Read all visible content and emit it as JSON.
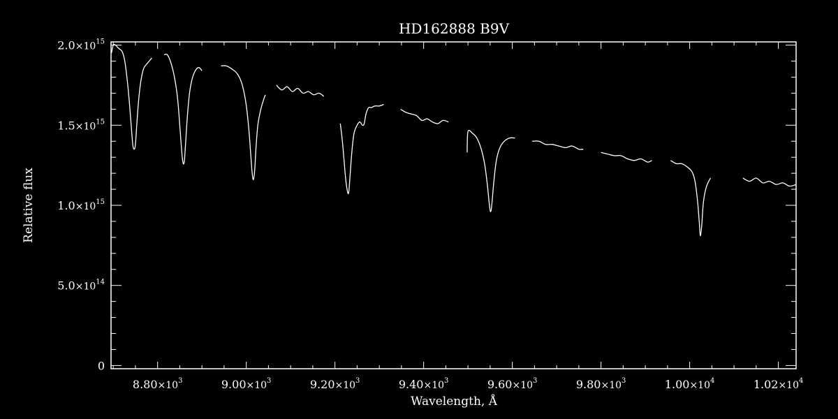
{
  "chart_data": {
    "type": "line",
    "title": "HD162888   B9V",
    "xlabel": "Wavelength, Å",
    "ylabel": "Relative flux",
    "xlim": [
      8695,
      10240
    ],
    "ylim": [
      -20000000000000.0,
      2020000000000000.0
    ],
    "x_ticks": [
      {
        "value": 8800,
        "mant": "8.80",
        "exp": "3"
      },
      {
        "value": 9000,
        "mant": "9.00",
        "exp": "3"
      },
      {
        "value": 9200,
        "mant": "9.20",
        "exp": "3"
      },
      {
        "value": 9400,
        "mant": "9.40",
        "exp": "3"
      },
      {
        "value": 9600,
        "mant": "9.60",
        "exp": "3"
      },
      {
        "value": 9800,
        "mant": "9.80",
        "exp": "3"
      },
      {
        "value": 10000,
        "mant": "1.00",
        "exp": "4"
      },
      {
        "value": 10200,
        "mant": "1.02",
        "exp": "4"
      }
    ],
    "y_ticks": [
      {
        "value": 0,
        "mant": "0",
        "exp": ""
      },
      {
        "value": 500000000000000.0,
        "mant": "5.0",
        "exp": "14"
      },
      {
        "value": 1000000000000000.0,
        "mant": "1.0",
        "exp": "15"
      },
      {
        "value": 1500000000000000.0,
        "mant": "1.5",
        "exp": "15"
      },
      {
        "value": 2000000000000000.0,
        "mant": "2.0",
        "exp": "15"
      }
    ],
    "grid": false,
    "line_color": "#ffffff",
    "background": "#000000",
    "series": [
      {
        "x": [
          8696,
          8700,
          8705,
          8712,
          8720,
          8726,
          8732,
          8737,
          8741,
          8744,
          8747,
          8750,
          8753,
          8757,
          8762,
          8768,
          8775,
          8781,
          8787
        ],
        "y": [
          1950000000000000.0,
          2000000000000000.0,
          2000000000000000.0,
          1980000000000000.0,
          1960000000000000.0,
          1900000000000000.0,
          1770000000000000.0,
          1620000000000000.0,
          1480000000000000.0,
          1380000000000000.0,
          1350000000000000.0,
          1380000000000000.0,
          1500000000000000.0,
          1650000000000000.0,
          1770000000000000.0,
          1850000000000000.0,
          1880000000000000.0,
          1900000000000000.0,
          1920000000000000.0
        ]
      },
      {
        "x": [
          8815,
          8822,
          8830,
          8838,
          8845,
          8850,
          8854,
          8857,
          8860,
          8863,
          8867,
          8872,
          8878,
          8885,
          8893,
          8900
        ],
        "y": [
          1940000000000000.0,
          1940000000000000.0,
          1890000000000000.0,
          1800000000000000.0,
          1670000000000000.0,
          1500000000000000.0,
          1350000000000000.0,
          1270000000000000.0,
          1270000000000000.0,
          1380000000000000.0,
          1550000000000000.0,
          1700000000000000.0,
          1790000000000000.0,
          1840000000000000.0,
          1860000000000000.0,
          1840000000000000.0
        ]
      },
      {
        "x": [
          8943,
          8955,
          8968,
          8980,
          8990,
          8998,
          9005,
          9010,
          9013,
          9016,
          9019,
          9022,
          9026,
          9032,
          9038,
          9043
        ],
        "y": [
          1870000000000000.0,
          1870000000000000.0,
          1850000000000000.0,
          1820000000000000.0,
          1760000000000000.0,
          1660000000000000.0,
          1500000000000000.0,
          1320000000000000.0,
          1210000000000000.0,
          1160000000000000.0,
          1220000000000000.0,
          1360000000000000.0,
          1500000000000000.0,
          1590000000000000.0,
          1650000000000000.0,
          1690000000000000.0
        ]
      },
      {
        "x": [
          9068,
          9080,
          9092,
          9104,
          9116,
          9128,
          9140,
          9152,
          9164,
          9175
        ],
        "y": [
          1750000000000000.0,
          1720000000000000.0,
          1740000000000000.0,
          1710000000000000.0,
          1730000000000000.0,
          1700000000000000.0,
          1710000000000000.0,
          1690000000000000.0,
          1700000000000000.0,
          1680000000000000.0
        ]
      },
      {
        "x": [
          9212,
          9216,
          9220,
          9224,
          9228,
          9231,
          9234,
          9238,
          9243,
          9250,
          9256,
          9262,
          9266,
          9270,
          9276,
          9282,
          9290,
          9300,
          9310
        ],
        "y": [
          1510000000000000.0,
          1420000000000000.0,
          1300000000000000.0,
          1170000000000000.0,
          1090000000000000.0,
          1080000000000000.0,
          1180000000000000.0,
          1330000000000000.0,
          1450000000000000.0,
          1500000000000000.0,
          1520000000000000.0,
          1500000000000000.0,
          1510000000000000.0,
          1570000000000000.0,
          1610000000000000.0,
          1610000000000000.0,
          1620000000000000.0,
          1620000000000000.0,
          1630000000000000.0
        ]
      },
      {
        "x": [
          9348,
          9360,
          9372,
          9384,
          9396,
          9408,
          9420,
          9432,
          9444,
          9456
        ],
        "y": [
          1600000000000000.0,
          1580000000000000.0,
          1570000000000000.0,
          1560000000000000.0,
          1530000000000000.0,
          1540000000000000.0,
          1520000000000000.0,
          1510000000000000.0,
          1530000000000000.0,
          1520000000000000.0
        ]
      },
      {
        "x": [
          9498,
          9500,
          9510,
          9520,
          9530,
          9538,
          9544,
          9548,
          9551,
          9554,
          9558,
          9564,
          9572,
          9582,
          9594,
          9606
        ],
        "y": [
          1330000000000000.0,
          1460000000000000.0,
          1450000000000000.0,
          1420000000000000.0,
          1350000000000000.0,
          1250000000000000.0,
          1120000000000000.0,
          1010000000000000.0,
          960000000000000.0,
          1010000000000000.0,
          1140000000000000.0,
          1280000000000000.0,
          1360000000000000.0,
          1400000000000000.0,
          1420000000000000.0,
          1420000000000000.0
        ]
      },
      {
        "x": [
          9645,
          9660,
          9675,
          9690,
          9705,
          9720,
          9735,
          9750,
          9760
        ],
        "y": [
          1400000000000000.0,
          1400000000000000.0,
          1380000000000000.0,
          1380000000000000.0,
          1370000000000000.0,
          1360000000000000.0,
          1370000000000000.0,
          1350000000000000.0,
          1350000000000000.0
        ]
      },
      {
        "x": [
          9800,
          9815,
          9830,
          9845,
          9860,
          9875,
          9890,
          9905,
          9915
        ],
        "y": [
          1330000000000000.0,
          1320000000000000.0,
          1310000000000000.0,
          1310000000000000.0,
          1290000000000000.0,
          1280000000000000.0,
          1290000000000000.0,
          1270000000000000.0,
          1280000000000000.0
        ]
      },
      {
        "x": [
          9957,
          9970,
          9982,
          9994,
          10005,
          10012,
          10018,
          10022,
          10024,
          10027,
          10031,
          10037,
          10043,
          10047
        ],
        "y": [
          1280000000000000.0,
          1260000000000000.0,
          1260000000000000.0,
          1240000000000000.0,
          1210000000000000.0,
          1150000000000000.0,
          1020000000000000.0,
          880000000000000.0,
          810000000000000.0,
          870000000000000.0,
          1020000000000000.0,
          1110000000000000.0,
          1150000000000000.0,
          1170000000000000.0
        ]
      },
      {
        "x": [
          10120,
          10135,
          10150,
          10165,
          10180,
          10195,
          10210,
          10225,
          10240
        ],
        "y": [
          1170000000000000.0,
          1150000000000000.0,
          1170000000000000.0,
          1140000000000000.0,
          1150000000000000.0,
          1130000000000000.0,
          1140000000000000.0,
          1120000000000000.0,
          1130000000000000.0
        ]
      }
    ]
  }
}
